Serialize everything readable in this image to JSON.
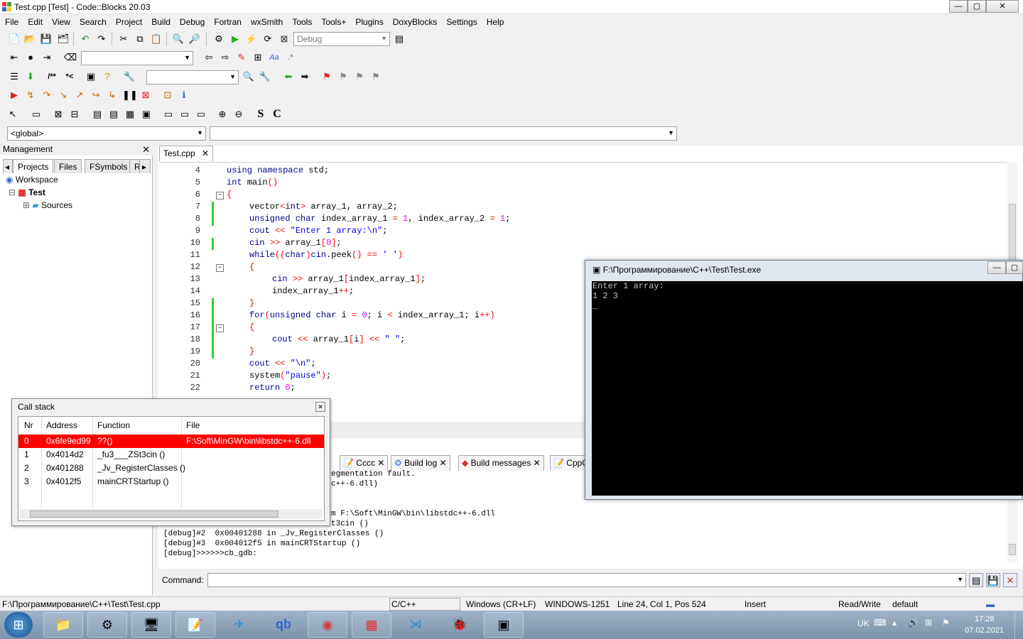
{
  "window": {
    "title": "Test.cpp [Test] - Code::Blocks 20.03",
    "min": "—",
    "max": "▢",
    "close": "✕"
  },
  "menu": [
    "File",
    "Edit",
    "View",
    "Search",
    "Project",
    "Build",
    "Debug",
    "Fortran",
    "wxSmith",
    "Tools",
    "Tools+",
    "Plugins",
    "DoxyBlocks",
    "Settings",
    "Help"
  ],
  "toolbar": {
    "build_target": "Debug"
  },
  "toolbar_format": {
    "bold": "S",
    "code": "C"
  },
  "scope": {
    "global": "<global>",
    "func": ""
  },
  "management": {
    "title": "Management",
    "tabs": [
      "Projects",
      "Files",
      "FSymbols",
      "R"
    ],
    "tree": {
      "workspace": "Workspace",
      "project": "Test",
      "folder": "Sources"
    }
  },
  "editor": {
    "tab": "Test.cpp",
    "lines": [
      {
        "n": "4",
        "code": [
          [
            "kw",
            "using namespace "
          ],
          [
            "",
            "std;"
          ]
        ],
        "ind": 0
      },
      {
        "n": "5",
        "code": [
          [
            "kw",
            "int "
          ],
          [
            "",
            "main"
          ],
          [
            "op",
            "()"
          ]
        ],
        "ind": 0
      },
      {
        "n": "6",
        "code": [
          [
            "op",
            "{"
          ]
        ],
        "ind": 0
      },
      {
        "n": "7",
        "code": [
          [
            "",
            "vector"
          ],
          [
            "op",
            "<"
          ],
          [
            "kw",
            "int"
          ],
          [
            "op",
            "> "
          ],
          [
            "",
            "array_1, array_2;"
          ]
        ],
        "ind": 1
      },
      {
        "n": "8",
        "code": [
          [
            "kw",
            "unsigned char "
          ],
          [
            "",
            "index_array_1 "
          ],
          [
            "op",
            "= "
          ],
          [
            "num",
            "1"
          ],
          [
            "",
            ", index_array_2 "
          ],
          [
            "op",
            "= "
          ],
          [
            "num",
            "1"
          ],
          [
            "",
            ";"
          ]
        ],
        "ind": 1
      },
      {
        "n": "9",
        "code": [
          [
            "kw",
            "cout "
          ],
          [
            "op",
            "<< "
          ],
          [
            "str",
            "\"Enter 1 array:\\n\""
          ],
          [
            "",
            ";"
          ]
        ],
        "ind": 1
      },
      {
        "n": "10",
        "code": [
          [
            "kw",
            "cin "
          ],
          [
            "op",
            ">> "
          ],
          [
            "",
            "array_1"
          ],
          [
            "op",
            "["
          ],
          [
            "num",
            "0"
          ],
          [
            "op",
            "]"
          ],
          [
            "",
            ";"
          ]
        ],
        "ind": 1
      },
      {
        "n": "11",
        "code": [
          [
            "kw",
            "while"
          ],
          [
            "op",
            "(("
          ],
          [
            "kw",
            "char"
          ],
          [
            "op",
            ")"
          ],
          [
            "kw",
            "cin"
          ],
          [
            "",
            ".peek"
          ],
          [
            "op",
            "() == "
          ],
          [
            "str",
            "' '"
          ],
          [
            "op",
            ")"
          ]
        ],
        "ind": 1
      },
      {
        "n": "12",
        "code": [
          [
            "op",
            "{"
          ]
        ],
        "ind": 1
      },
      {
        "n": "13",
        "code": [
          [
            "kw",
            "cin "
          ],
          [
            "op",
            ">> "
          ],
          [
            "",
            "array_1"
          ],
          [
            "op",
            "["
          ],
          [
            "",
            "index_array_1"
          ],
          [
            "op",
            "]"
          ],
          [
            "",
            ";"
          ]
        ],
        "ind": 2
      },
      {
        "n": "14",
        "code": [
          [
            "",
            "index_array_1"
          ],
          [
            "op",
            "++"
          ],
          [
            "",
            ";"
          ]
        ],
        "ind": 2
      },
      {
        "n": "15",
        "code": [
          [
            "op",
            "}"
          ]
        ],
        "ind": 1
      },
      {
        "n": "16",
        "code": [
          [
            "kw",
            "for"
          ],
          [
            "op",
            "("
          ],
          [
            "kw",
            "unsigned char "
          ],
          [
            "",
            "i "
          ],
          [
            "op",
            "= "
          ],
          [
            "num",
            "0"
          ],
          [
            "",
            "; i "
          ],
          [
            "op",
            "< "
          ],
          [
            "",
            "index_array_1; i"
          ],
          [
            "op",
            "++)"
          ]
        ],
        "ind": 1
      },
      {
        "n": "17",
        "code": [
          [
            "op",
            "{"
          ]
        ],
        "ind": 1
      },
      {
        "n": "18",
        "code": [
          [
            "kw",
            "cout "
          ],
          [
            "op",
            "<< "
          ],
          [
            "",
            "array_1"
          ],
          [
            "op",
            "["
          ],
          [
            "",
            "i"
          ],
          [
            "op",
            "] << "
          ],
          [
            "str",
            "\" \""
          ],
          [
            "",
            ";"
          ]
        ],
        "ind": 2
      },
      {
        "n": "19",
        "code": [
          [
            "op",
            "}"
          ]
        ],
        "ind": 1
      },
      {
        "n": "20",
        "code": [
          [
            "kw",
            "cout "
          ],
          [
            "op",
            "<< "
          ],
          [
            "str",
            "\"\\n\""
          ],
          [
            "",
            ";"
          ]
        ],
        "ind": 1
      },
      {
        "n": "21",
        "code": [
          [
            "",
            "system"
          ],
          [
            "op",
            "("
          ],
          [
            "str",
            "\"pause\""
          ],
          [
            "op",
            ")"
          ],
          [
            "",
            ";"
          ]
        ],
        "ind": 1
      },
      {
        "n": "22",
        "code": [
          [
            "kw",
            "return "
          ],
          [
            "num",
            "0"
          ],
          [
            "",
            ";"
          ]
        ],
        "ind": 1
      }
    ]
  },
  "console": {
    "title": "F:\\Программирование\\C++\\Test\\Test.exe",
    "lines": [
      "Enter 1 array:",
      "1 2 3",
      "_"
    ]
  },
  "logs": {
    "tabs": [
      "Cccc",
      "Build log",
      "Build messages",
      "CppC"
    ],
    "lines": [
      "egmentation fault.",
      "c++-6.dll)",
      "",
      "",
      "m F:\\Soft\\MinGW\\bin\\libstdc++-6.dll",
      "t3cin ()",
      "[debug]#2  0x00401288 in _Jv_RegisterClasses ()",
      "[debug]#3  0x004012f5 in mainCRTStartup ()",
      "[debug]>>>>>>cb_gdb:"
    ],
    "command_label": "Command:"
  },
  "callstack": {
    "title": "Call stack",
    "headers": [
      "Nr",
      "Address",
      "Function",
      "File"
    ],
    "rows": [
      {
        "nr": "0",
        "addr": "0x6fe9ed99",
        "func": "??()",
        "file": "F:\\Soft\\MinGW\\bin\\libstdc++-6.dll"
      },
      {
        "nr": "1",
        "addr": "0x4014d2",
        "func": "_fu3___ZSt3cin ()",
        "file": ""
      },
      {
        "nr": "2",
        "addr": "0x401288",
        "func": "_Jv_RegisterClasses ()",
        "file": ""
      },
      {
        "nr": "3",
        "addr": "0x4012f5",
        "func": "mainCRTStartup ()",
        "file": ""
      }
    ],
    "highlight": "#ff0000"
  },
  "status": {
    "path": "F:\\Программирование\\C++\\Test\\Test.cpp",
    "lang": "C/C++",
    "eol": "Windows (CR+LF)",
    "enc": "WINDOWS-1251",
    "pos": "Line 24, Col 1, Pos 524",
    "mode": "Insert",
    "rw": "Read/Write",
    "profile": "default"
  },
  "tray": {
    "lang": "UK",
    "time": "17:28",
    "date": "07.02.2021"
  }
}
